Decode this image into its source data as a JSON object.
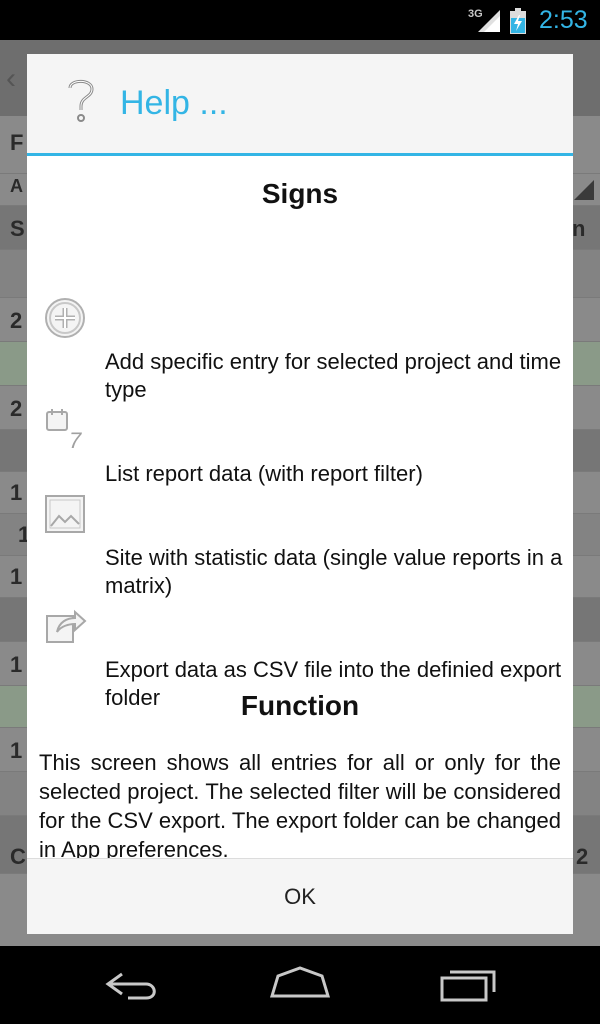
{
  "status_bar": {
    "network": "3G",
    "time": "2:53",
    "accent_color": "#33b5e5"
  },
  "background": {
    "row_chars": [
      "F",
      "A",
      "S",
      "2",
      "2",
      "1",
      "1",
      "1",
      "1",
      "1",
      "C"
    ],
    "right_chars": [
      "n",
      "2"
    ]
  },
  "dialog": {
    "icon": "question-mark-icon",
    "title": "Help ...",
    "signs_heading": "Signs",
    "signs": [
      {
        "icon": "add-circle-icon",
        "text": "Add specific entry for selected project and time type"
      },
      {
        "icon": "calendar-list-icon",
        "text": "List report data (with report filter)"
      },
      {
        "icon": "picture-statistic-icon",
        "text": "Site with statistic data (single value reports in a matrix)"
      },
      {
        "icon": "export-share-icon",
        "text": "Export data as CSV file into the definied export folder"
      }
    ],
    "function_heading": "Function",
    "function_text": "This screen shows all entries for all or only for the selected project. The selected filter will be considered for the CSV export. The export folder can be changed in App preferences.",
    "ok_label": "OK"
  },
  "nav_bar": {
    "back": "back-icon",
    "home": "home-icon",
    "recents": "recent-apps-icon"
  }
}
